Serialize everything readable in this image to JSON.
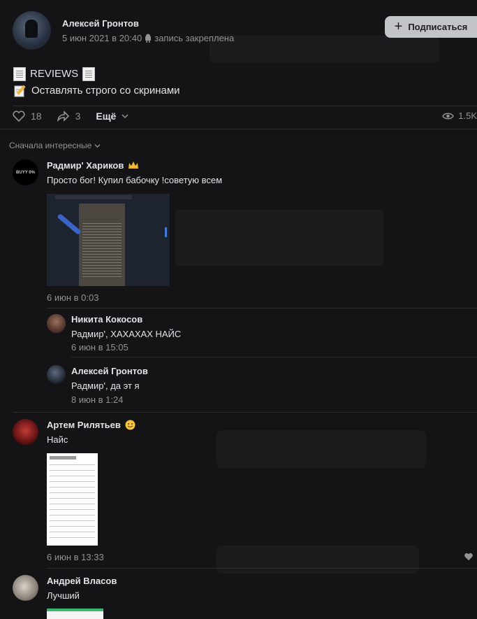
{
  "post": {
    "author": "Алексей Гронтов",
    "date": "5 июн 2021 в 20:40",
    "pinned_label": "запись закреплена",
    "subscribe_label": "Подписаться",
    "line1": "REVIEWS",
    "line2": "Оставлять строго со скринами",
    "likes": "18",
    "shares": "3",
    "more_label": "Ещё",
    "views": "1.5K"
  },
  "comments_sort": "Сначала интересные",
  "comments": [
    {
      "name": "Радмир' Хариков",
      "text": "Просто бог! Купил бабочку !советую всем",
      "date": "6 июн в 0:03",
      "avatar_text": "BUYY 0%"
    },
    {
      "name": "Никита Кокосов",
      "text": "Радмир', ХАХАХАХ НАЙС",
      "date": "6 июн в 15:05"
    },
    {
      "name": "Алексей Гронтов",
      "text": "Радмир', да эт я",
      "date": "8 июн в 1:24"
    },
    {
      "name": "Артем Рилятьев",
      "text": "Найс",
      "date": "6 июн в 13:33"
    },
    {
      "name": "Андрей Власов",
      "text": "Лучший"
    }
  ],
  "colors": {
    "background": "#141416",
    "text": "#e1e3e6",
    "muted": "#939393",
    "divider": "#2d2d30"
  }
}
